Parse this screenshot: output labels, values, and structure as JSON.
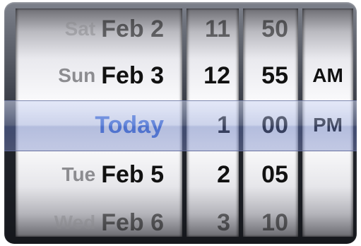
{
  "date_wheel": {
    "rows": [
      {
        "day": "Sat",
        "date": "Feb 2"
      },
      {
        "day": "Sun",
        "date": "Feb 3"
      },
      {
        "day": "",
        "date": "Today"
      },
      {
        "day": "Tue",
        "date": "Feb 5"
      },
      {
        "day": "Wed",
        "date": "Feb 6"
      }
    ]
  },
  "hour_wheel": {
    "rows": [
      "11",
      "12",
      "1",
      "2",
      "3"
    ]
  },
  "minute_wheel": {
    "rows": [
      "50",
      "55",
      "00",
      "05",
      "10"
    ]
  },
  "ampm_wheel": {
    "rows": [
      "AM",
      "PM"
    ]
  },
  "selected": {
    "date": "Today",
    "hour": "1",
    "minute": "00",
    "period": "PM"
  },
  "colors": {
    "today": "#3f6fdd",
    "day_label": "#8c8c90",
    "selection_bar": "#8e9ad4"
  }
}
